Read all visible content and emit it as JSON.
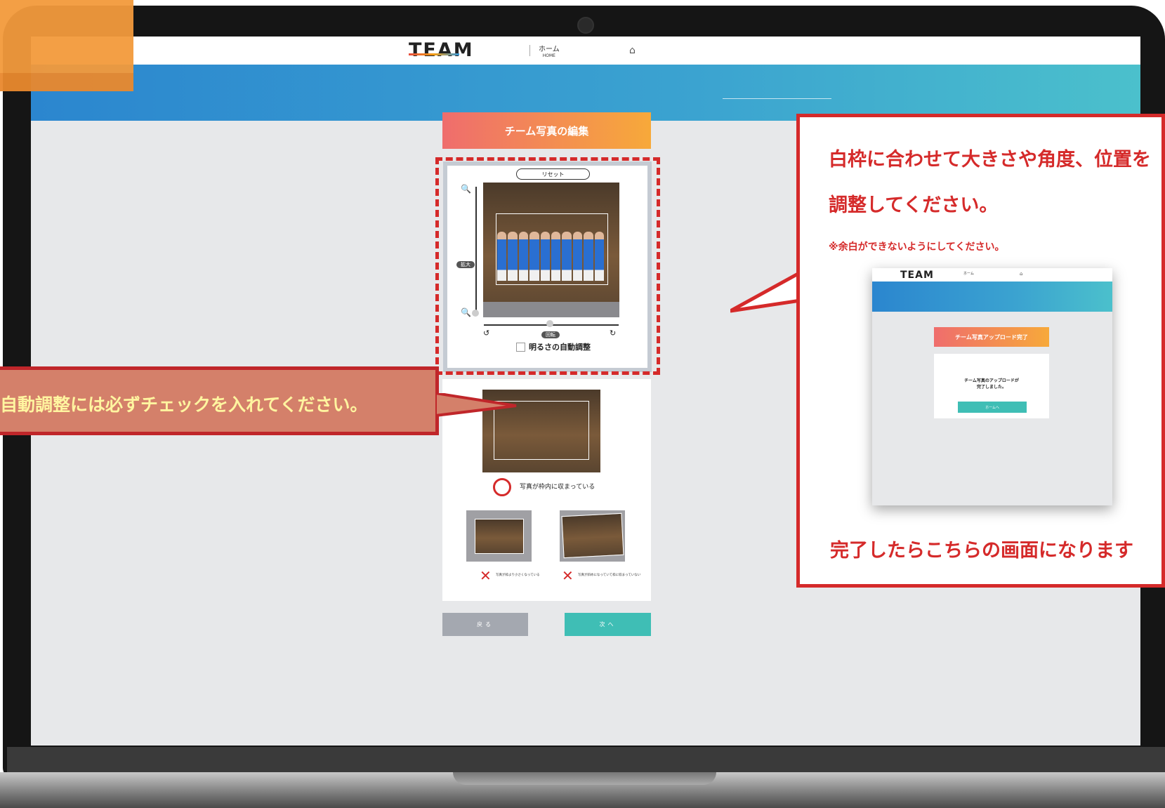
{
  "header": {
    "logo": "TEAM",
    "home_label": "ホーム",
    "home_sub": "HOME"
  },
  "editor": {
    "title": "チーム写真の編集",
    "reset_label": "リセット",
    "zoom_badge": "拡大",
    "rotate_badge": "回転",
    "brightness_label": "明るさの自動調整",
    "brightness_checked": false
  },
  "examples": {
    "ok_label": "写真が枠内に収まっている",
    "bad1_label": "写真が枠より小さくなっている",
    "bad2_label": "写真が斜めになっていて枠に収まっていない"
  },
  "buttons": {
    "back": "戻る",
    "next": "次へ"
  },
  "callout_right": {
    "line1": "白枠に合わせて大きさや角度、位置を",
    "line2": "調整してください。",
    "note": "※余白ができないようにしてください。",
    "done": "完了したらこちらの画面になります"
  },
  "preview": {
    "logo": "TEAM",
    "home_label": "ホーム",
    "home_sub": "HOME",
    "title": "チーム写真アップロード完了",
    "message_line1": "チーム写真のアップロードが",
    "message_line2": "完了しました。",
    "button": "ホームへ"
  },
  "callout_left": {
    "text": "自動調整には必ずチェックを入れてください。"
  },
  "colors": {
    "accent_red": "#d52a2a",
    "teal": "#3fbeb5",
    "banner_blue": "#2b86cf"
  },
  "icons": [
    "zoom-in-icon",
    "zoom-out-icon",
    "rotate-left-icon",
    "rotate-right-icon",
    "school-icon",
    "check-circle-icon",
    "cross-icon"
  ]
}
